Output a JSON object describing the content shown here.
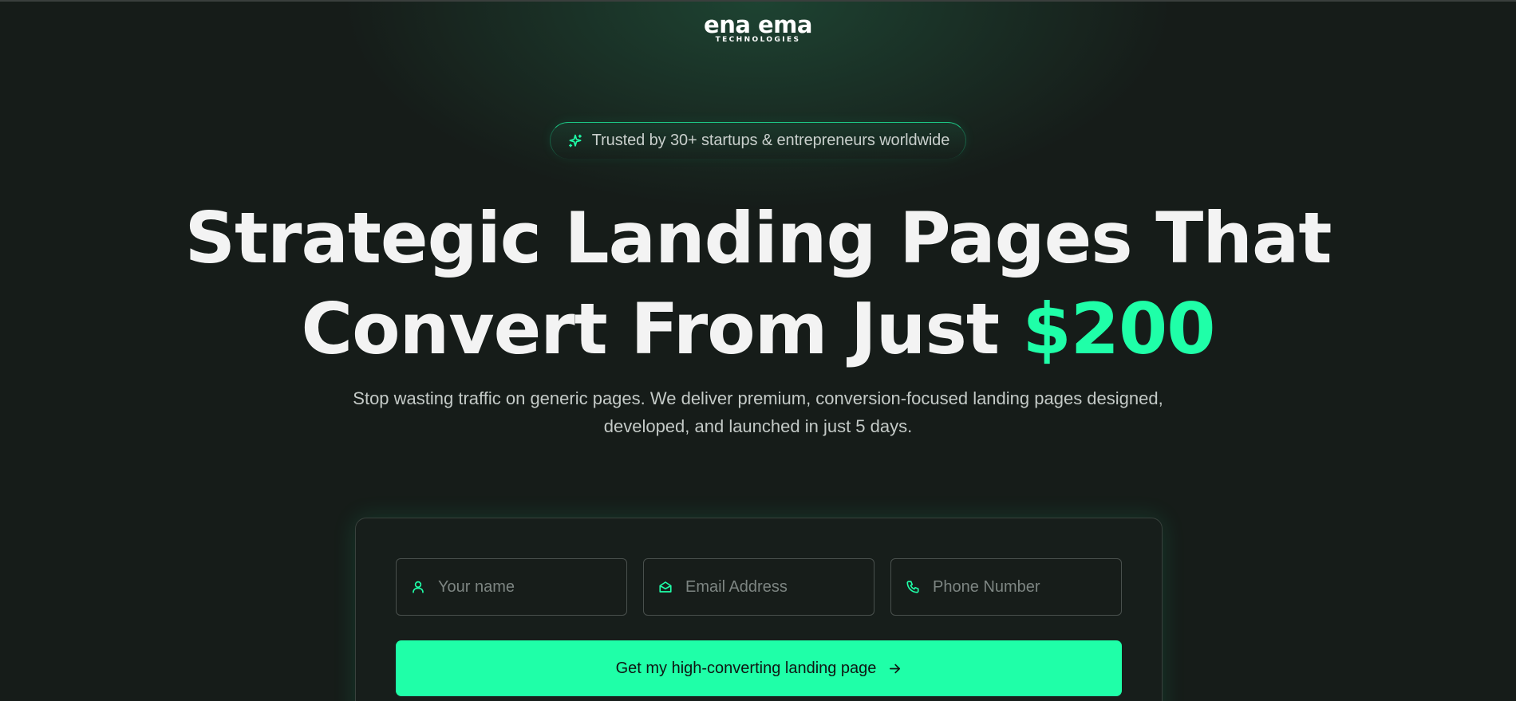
{
  "brand": {
    "name": "ena ema",
    "tagline": "TECHNOLOGIES"
  },
  "badge": {
    "icon": "sparkle-icon",
    "text": "Trusted by 30+ startups & entrepreneurs worldwide"
  },
  "hero": {
    "headline_line1": "Strategic Landing Pages That",
    "headline_line2": "Convert From Just",
    "headline_price": "$200",
    "subtext": "Stop wasting traffic on generic pages. We deliver premium, conversion-focused landing pages designed, developed, and launched in just 5 days."
  },
  "form": {
    "name_placeholder": "Your name",
    "email_placeholder": "Email Address",
    "phone_placeholder": "Phone Number",
    "name_icon": "user-icon",
    "email_icon": "mail-icon",
    "phone_icon": "phone-icon",
    "submit_label": "Get my high-converting landing page",
    "submit_icon": "arrow-right-icon"
  },
  "colors": {
    "accent": "#1fffa8",
    "background": "#161c19",
    "card": "#171e1b",
    "text": "#f3f3f3",
    "muted_text": "#c4cac7"
  }
}
